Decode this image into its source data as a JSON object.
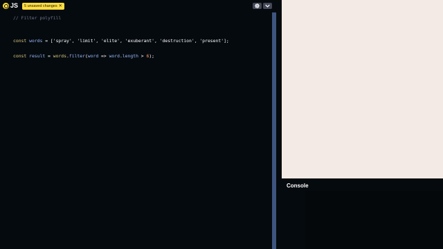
{
  "editor": {
    "language_label": "JS",
    "unsaved_badge": "5 unsaved changes",
    "unsaved_close": "✕",
    "lines": [
      [
        {
          "t": "// Filter polyfill",
          "c": "c-comment"
        }
      ],
      [],
      [],
      [
        {
          "t": "const ",
          "c": "c-kw"
        },
        {
          "t": "words",
          "c": "c-var"
        },
        {
          "t": " = [",
          "c": "c-plain"
        },
        {
          "t": "'spray'",
          "c": "c-plain"
        },
        {
          "t": ", ",
          "c": "c-plain"
        },
        {
          "t": "'limit'",
          "c": "c-plain"
        },
        {
          "t": ", ",
          "c": "c-plain"
        },
        {
          "t": "'elite'",
          "c": "c-plain"
        },
        {
          "t": ", ",
          "c": "c-plain"
        },
        {
          "t": "'exuberant'",
          "c": "c-plain"
        },
        {
          "t": ", ",
          "c": "c-plain"
        },
        {
          "t": "'destruction'",
          "c": "c-plain"
        },
        {
          "t": ", ",
          "c": "c-plain"
        },
        {
          "t": "'present'",
          "c": "c-plain"
        },
        {
          "t": "];",
          "c": "c-plain"
        }
      ],
      [],
      [
        {
          "t": "const ",
          "c": "c-kw"
        },
        {
          "t": "result",
          "c": "c-var"
        },
        {
          "t": " = ",
          "c": "c-plain"
        },
        {
          "t": "words",
          "c": "c-fn"
        },
        {
          "t": ".",
          "c": "c-plain"
        },
        {
          "t": "filter",
          "c": "c-var"
        },
        {
          "t": "(",
          "c": "c-plain"
        },
        {
          "t": "word",
          "c": "c-var"
        },
        {
          "t": " => ",
          "c": "c-plain"
        },
        {
          "t": "word",
          "c": "c-var"
        },
        {
          "t": ".",
          "c": "c-plain"
        },
        {
          "t": "length",
          "c": "c-var"
        },
        {
          "t": " > ",
          "c": "c-plain"
        },
        {
          "t": "6",
          "c": "c-num"
        },
        {
          "t": ");",
          "c": "c-plain"
        }
      ]
    ]
  },
  "header_icons": {
    "settings": "gear-icon",
    "collapse": "chevron-down-icon"
  },
  "console": {
    "title": "Console"
  },
  "colors": {
    "accent_yellow": "#ffdd40",
    "editor_bg": "#050a0e",
    "resizer": "#3d5580",
    "preview_bg": "#f3eae6"
  }
}
